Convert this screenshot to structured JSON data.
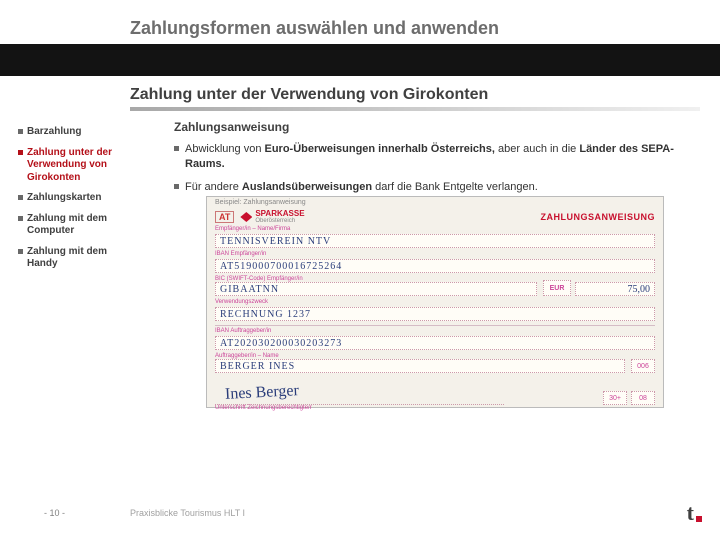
{
  "header": {
    "title": "Zahlungsformen auswählen und anwenden",
    "subtitle": "Zahlung unter der Verwendung von Girokonten"
  },
  "sidebar": {
    "items": [
      {
        "label": "Barzahlung",
        "current": false
      },
      {
        "label": "Zahlung unter der Verwendung von Girokonten",
        "current": true
      },
      {
        "label": "Zahlungskarten",
        "current": false
      },
      {
        "label": "Zahlung mit dem Computer",
        "current": false
      },
      {
        "label": "Zahlung mit dem Handy",
        "current": false
      }
    ]
  },
  "content": {
    "section_title": "Zahlungsanweisung",
    "b1_pre": "Abwicklung von ",
    "b1_bold": "Euro-Überweisungen innerhalb Österreichs,",
    "b1_post": " aber auch in die ",
    "b1_bold2": "Länder des SEPA-Raums.",
    "b2_pre": "Für andere ",
    "b2_bold": "Auslandsüberweisungen",
    "b2_post": " darf die Bank Entgelte verlangen."
  },
  "form": {
    "caption": "Beispiel: Zahlungsanweisung",
    "country": "AT",
    "bank_name": "SPARKASSE",
    "bank_sub": "Oberösterreich",
    "doc_title": "ZAHLUNGSANWEISUNG",
    "cap_recipient": "Empfänger/in – Name/Firma",
    "recipient": "TENNISVEREIN NTV",
    "cap_iban_recipient": "IBAN Empfänger/in",
    "iban_recipient": "AT519000700016725264",
    "cap_bic": "BIC (SWIFT-Code) Empfänger/in",
    "bic": "GIBAATNN",
    "currency_label": "EUR",
    "amount": "75,00",
    "cap_purpose": "Verwendungszweck",
    "purpose": "RECHNUNG 1237",
    "cap_iban_payer": "IBAN Auftraggeber/in",
    "iban_payer": "AT202030200030203273",
    "cap_payer": "Auftraggeber/in – Name",
    "payer": "BERGER INES",
    "code_right": "006",
    "sig_caption": "Unterschrift Zeichnungsberechtigte/r",
    "signature": "Ines Berger",
    "tiny1": "30+",
    "tiny2": "08"
  },
  "footer": {
    "page": "- 10 -",
    "text": "Praxisblicke Tourismus HLT I"
  }
}
